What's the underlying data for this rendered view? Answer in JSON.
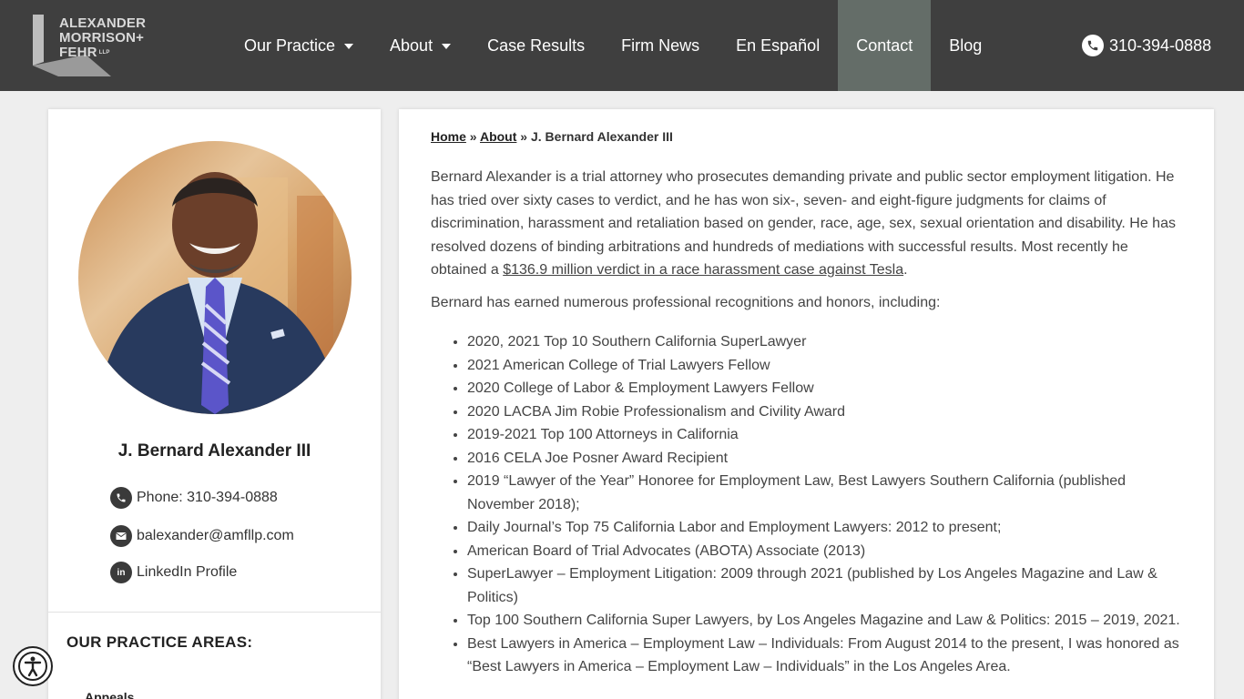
{
  "header": {
    "logo": {
      "line1": "ALEXANDER",
      "line2": "MORRISON+",
      "line3": "FEHR",
      "suffix": "LLP"
    },
    "nav": [
      {
        "label": "Our Practice",
        "has_dropdown": true,
        "active": false
      },
      {
        "label": "About",
        "has_dropdown": true,
        "active": false
      },
      {
        "label": "Case Results",
        "has_dropdown": false,
        "active": false
      },
      {
        "label": "Firm News",
        "has_dropdown": false,
        "active": false
      },
      {
        "label": "En Español",
        "has_dropdown": false,
        "active": false
      },
      {
        "label": "Contact",
        "has_dropdown": false,
        "active": true
      },
      {
        "label": "Blog",
        "has_dropdown": false,
        "active": false
      }
    ],
    "phone": "310-394-0888",
    "phone_icon": "phone-icon"
  },
  "sidebar": {
    "name": "J. Bernard Alexander III",
    "phone": "Phone: 310-394-0888",
    "email": "balexander@amfllp.com",
    "linkedin": "LinkedIn Profile",
    "linkedin_icon_text": "in",
    "practice_heading": "OUR PRACTICE AREAS:",
    "practice_first": "Appeals"
  },
  "main": {
    "breadcrumb": {
      "home": "Home",
      "sep1": "»",
      "about": "About",
      "sep2": "»",
      "current": "J. Bernard Alexander III"
    },
    "bio_text": "Bernard Alexander is a trial attorney who prosecutes demanding private and public sector employment litigation. He has tried over sixty cases to verdict, and he has won six-, seven- and eight-figure judgments for claims of discrimination, harassment and retaliation based on gender, race, age, sex, sexual orientation and disability.  He has resolved dozens of binding arbitrations and hundreds of mediations with successful results.  Most recently he obtained a ",
    "bio_link": "$136.9 million verdict in a race harassment case against Tesla",
    "bio_end": ".",
    "honors_intro": "Bernard has earned numerous professional recognitions and honors, including:",
    "honors": [
      "2020, 2021 Top 10 Southern California SuperLawyer",
      "2021 American College of Trial Lawyers Fellow",
      "2020 College of Labor & Employment Lawyers Fellow",
      "2020 LACBA Jim Robie Professionalism and Civility Award",
      "2019-2021 Top 100 Attorneys in California",
      "2016 CELA Joe Posner Award Recipient",
      "2019 “Lawyer of the Year” Honoree for Employment Law, Best Lawyers Southern California (published November 2018);",
      "Daily Journal’s Top 75 California Labor and Employment Lawyers: 2012 to present;",
      "American Board of Trial Advocates (ABOTA) Associate (2013)",
      "SuperLawyer – Employment Litigation: 2009 through 2021 (published by Los Angeles Magazine and Law & Politics)",
      "Top 100 Southern California Super Lawyers, by Los Angeles Magazine and Law & Politics: 2015 – 2019, 2021.",
      "Best Lawyers in America – Employment Law – Individuals: From August 2014 to the present, I was honored as “Best Lawyers in America – Employment Law – Individuals” in the Los Angeles Area."
    ]
  },
  "colors": {
    "header_bg": "#3f3f3f",
    "nav_active_bg": "#646d68",
    "page_bg": "#eeeeee"
  }
}
